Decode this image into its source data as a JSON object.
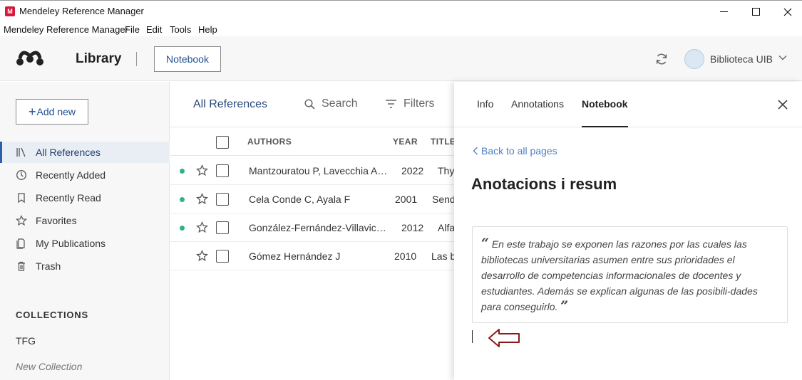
{
  "window": {
    "title": "Mendeley Reference Manager",
    "menu": [
      "Mendeley Reference Manager",
      "File",
      "Edit",
      "Tools",
      "Help"
    ]
  },
  "header": {
    "section_title": "Library",
    "notebook_button": "Notebook",
    "account_name": "Biblioteca UIB"
  },
  "sidebar": {
    "add_new": "Add new",
    "items": [
      {
        "label": "All References",
        "icon": "library-icon",
        "active": true
      },
      {
        "label": "Recently Added",
        "icon": "clock-icon"
      },
      {
        "label": "Recently Read",
        "icon": "bookmark-icon"
      },
      {
        "label": "Favorites",
        "icon": "star-icon"
      },
      {
        "label": "My Publications",
        "icon": "document-icon"
      },
      {
        "label": "Trash",
        "icon": "trash-icon"
      }
    ],
    "collections_heading": "COLLECTIONS",
    "collections": [
      "TFG"
    ],
    "new_collection": "New Collection"
  },
  "main": {
    "title": "All References",
    "search_label": "Search",
    "filters_label": "Filters",
    "columns": {
      "authors": "AUTHORS",
      "year": "YEAR",
      "title": "TITLE"
    },
    "rows": [
      {
        "authors": "Mantzouratou P, Lavecchia A…",
        "year": "2022",
        "title": "Thy",
        "unread": true
      },
      {
        "authors": "Cela Conde C, Ayala F",
        "year": "2001",
        "title": "Send",
        "unread": true
      },
      {
        "authors": "González-Fernández-Villavic…",
        "year": "2012",
        "title": "Alfa",
        "unread": true
      },
      {
        "authors": "Gómez Hernández J",
        "year": "2010",
        "title": "Las b",
        "unread": false
      }
    ]
  },
  "panel": {
    "tabs": [
      "Info",
      "Annotations",
      "Notebook"
    ],
    "active_tab": "Notebook",
    "back_link": "Back to all pages",
    "page_title": "Anotacions i resum",
    "quote_open": "“",
    "quote_text": "En este trabajo se exponen las razones por las cuales las bibliotecas universitarias asumen entre sus prioridades el desarrollo de competencias informacionales de docentes y estudiantes. Además se explican algunas de las posibili-dades para conseguirlo.",
    "quote_close": "”"
  },
  "colors": {
    "accent_blue": "#2a5ea8",
    "unread_dot": "#2fb28a",
    "app_red": "#d4193c",
    "annotation_arrow": "#8b1a1a"
  }
}
